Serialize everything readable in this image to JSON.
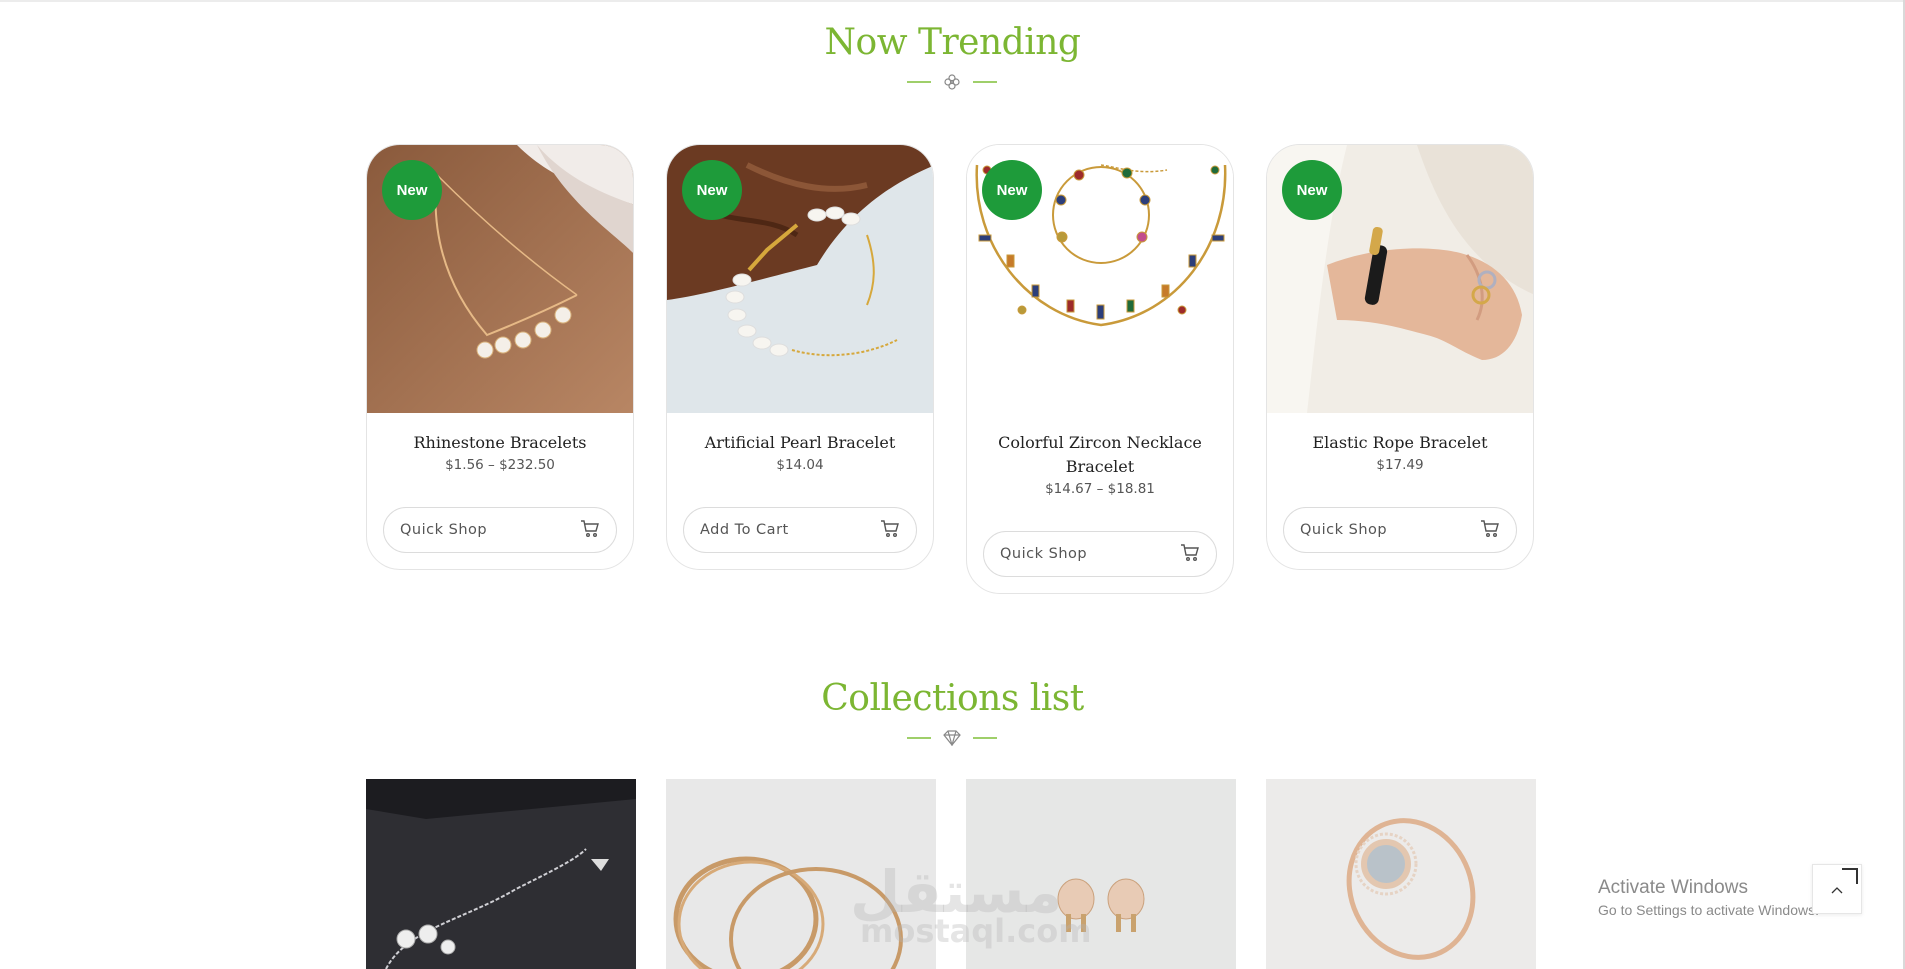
{
  "trending": {
    "title": "Now Trending",
    "products": [
      {
        "badge": "New",
        "title": "Rhinestone Bracelets",
        "price": "$1.56 – $232.50",
        "button": "Quick Shop"
      },
      {
        "badge": "New",
        "title": "Artificial Pearl Bracelet",
        "price": "$14.04",
        "button": "Add To Cart"
      },
      {
        "badge": "New",
        "title": "Colorful Zircon Necklace Bracelet",
        "price": "$14.67 – $18.81",
        "button": "Quick Shop"
      },
      {
        "badge": "New",
        "title": "Elastic Rope Bracelet",
        "price": "$17.49",
        "button": "Quick Shop"
      }
    ]
  },
  "collections": {
    "title": "Collections list"
  },
  "watermark": {
    "line1": "مستقل",
    "line2": "mostaql.com"
  },
  "windows_notice": {
    "line1": "Activate Windows",
    "line2": "Go to Settings to activate Windows."
  },
  "icons": {
    "trending_ornament": "flower-icon",
    "collections_ornament": "diamond-icon",
    "cart": "cart-icon",
    "back_to_top": "chevron-up-icon"
  },
  "colors": {
    "accent": "#7cb633",
    "badge": "#1e9b3a"
  }
}
